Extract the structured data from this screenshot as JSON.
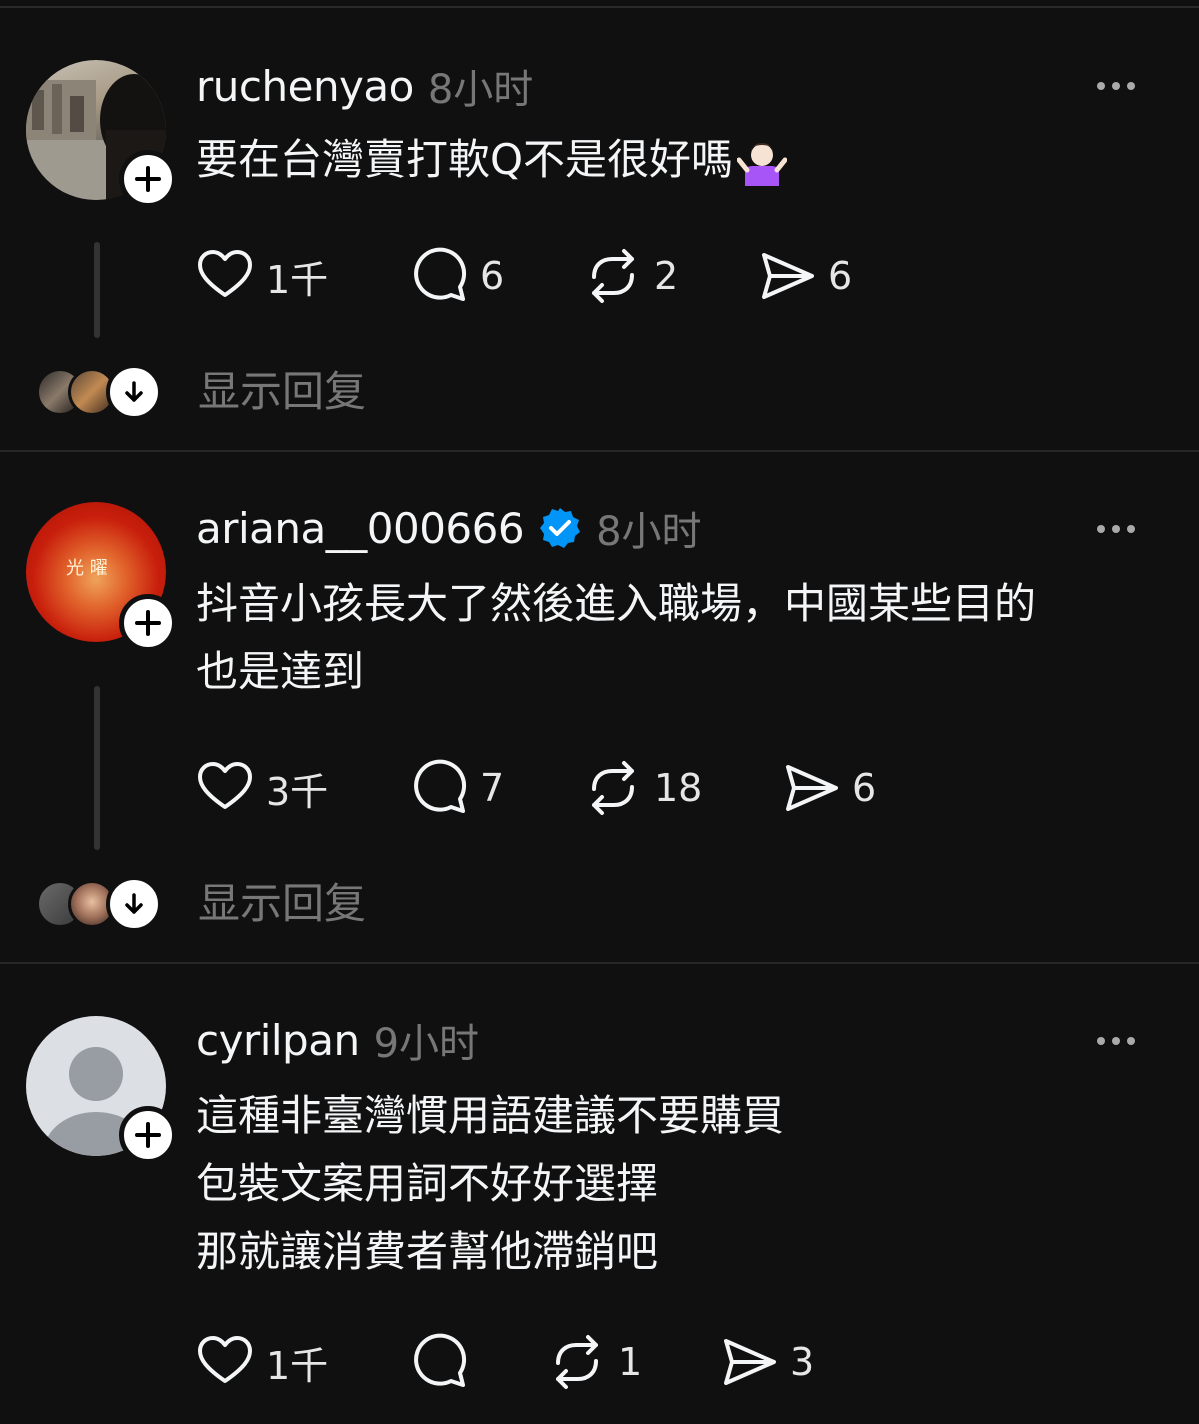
{
  "posts": [
    {
      "username": "ruchenyao",
      "time": "8小时",
      "verified": false,
      "text_lines": [
        "要在台灣賣打軟Q不是很好嗎"
      ],
      "emoji": "person-shrugging-emoji",
      "likes": "1千",
      "comments": "6",
      "reposts": "2",
      "shares": "6",
      "show_replies": "显示回复"
    },
    {
      "username": "ariana__000666",
      "time": "8小时",
      "verified": true,
      "avatar_text": "光 曜",
      "text_lines": [
        "抖音小孩長大了然後進入職場，中國某些目的",
        "也是達到"
      ],
      "likes": "3千",
      "comments": "7",
      "reposts": "18",
      "shares": "6",
      "show_replies": "显示回复"
    },
    {
      "username": "cyrilpan",
      "time": "9小时",
      "verified": false,
      "text_lines": [
        "這種非臺灣慣用語建議不要購買",
        "包裝文案用詞不好好選擇",
        "那就讓消費者幫他滯銷吧"
      ],
      "likes": "1千",
      "comments": "",
      "reposts": "1",
      "shares": "3"
    }
  ],
  "colors": {
    "background": "#101010",
    "text": "#f3f5f7",
    "muted": "#777777",
    "verified": "#0095f6"
  }
}
